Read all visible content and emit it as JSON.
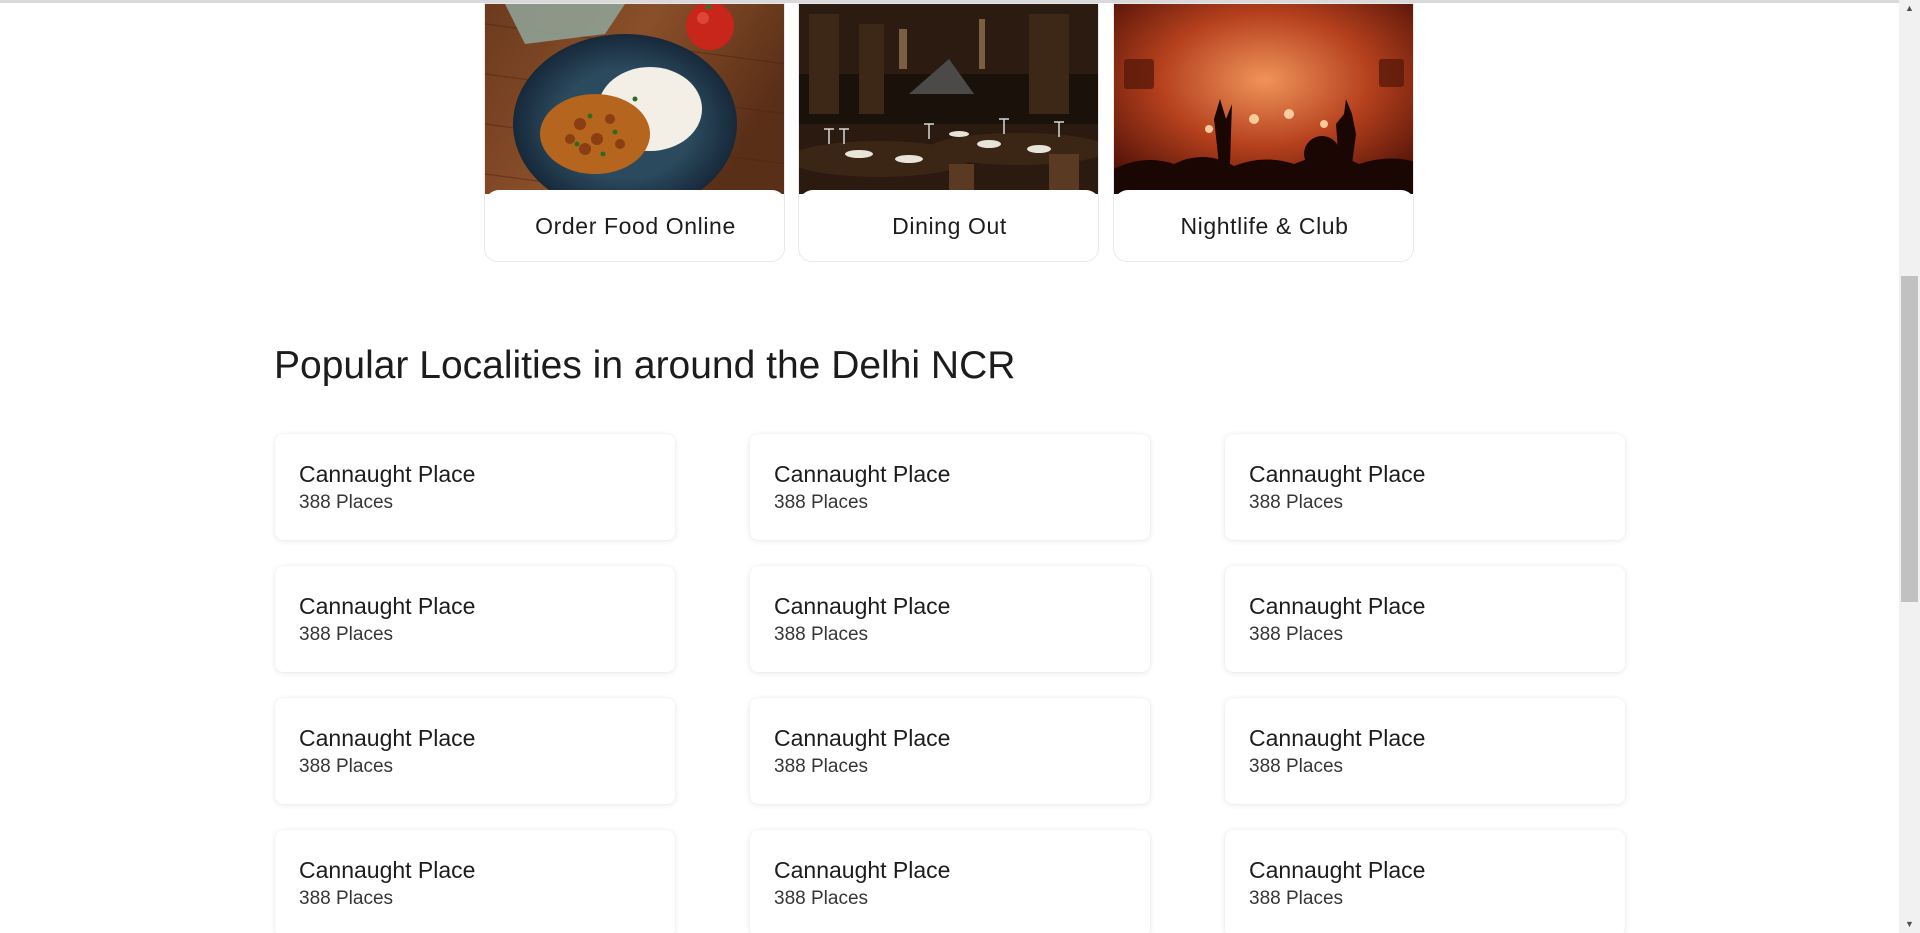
{
  "categories": [
    {
      "label": "Order Food Online",
      "icon": "food-plate-image"
    },
    {
      "label": "Dining Out",
      "icon": "restaurant-interior-image"
    },
    {
      "label": "Nightlife & Club",
      "icon": "nightclub-crowd-image"
    }
  ],
  "localities_section": {
    "title": "Popular Localities in around the Delhi NCR",
    "items": [
      {
        "name": "Cannaught Place",
        "count": "388 Places"
      },
      {
        "name": "Cannaught Place",
        "count": "388 Places"
      },
      {
        "name": "Cannaught Place",
        "count": "388 Places"
      },
      {
        "name": "Cannaught Place",
        "count": "388 Places"
      },
      {
        "name": "Cannaught Place",
        "count": "388 Places"
      },
      {
        "name": "Cannaught Place",
        "count": "388 Places"
      },
      {
        "name": "Cannaught Place",
        "count": "388 Places"
      },
      {
        "name": "Cannaught Place",
        "count": "388 Places"
      },
      {
        "name": "Cannaught Place",
        "count": "388 Places"
      },
      {
        "name": "Cannaught Place",
        "count": "388 Places"
      },
      {
        "name": "Cannaught Place",
        "count": "388 Places"
      },
      {
        "name": "Cannaught Place",
        "count": "388 Places"
      }
    ]
  },
  "scrollbar": {
    "up_icon": "scroll-up-arrow-icon",
    "down_icon": "scroll-down-arrow-icon"
  }
}
